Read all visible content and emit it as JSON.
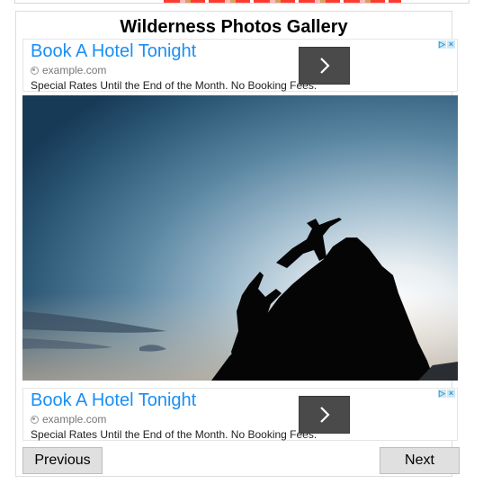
{
  "page": {
    "title": "Wilderness Photos Gallery"
  },
  "ads": [
    {
      "headline": "Book A Hotel Tonight",
      "url": "example.com",
      "description": "Special Rates Until the End of the Month. No Booking Fees.",
      "cta_icon": "chevron-right-icon",
      "adchoices_icon": "adchoices-icon",
      "close_icon": "close-icon"
    },
    {
      "headline": "Book A Hotel Tonight",
      "url": "example.com",
      "description": "Special Rates Until the End of the Month. No Booking Fees.",
      "cta_icon": "chevron-right-icon",
      "adchoices_icon": "adchoices-icon",
      "close_icon": "close-icon"
    }
  ],
  "photo": {
    "description": "Silhouette of two climbers helping each other up a rock peak against a blue sky"
  },
  "navigation": {
    "previous_label": "Previous",
    "next_label": "Next"
  },
  "colors": {
    "ad_headline": "#1a8ef5",
    "cta_button": "#4a4a4a",
    "nav_button": "#dedede"
  }
}
